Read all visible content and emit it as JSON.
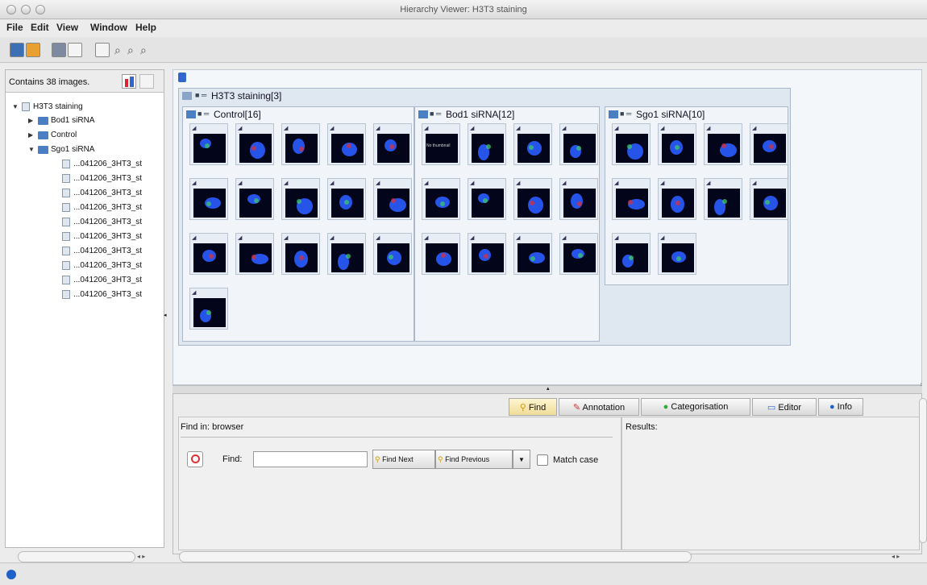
{
  "window": {
    "title": "Hierarchy Viewer: H3T3 staining"
  },
  "menubar": {
    "items": [
      "File",
      "Edit",
      "View",
      "Window",
      "Help"
    ]
  },
  "toolbar": {
    "icons": [
      "view-icon",
      "view-alt-icon",
      "grid-icon",
      "refresh-icon",
      "zoom-icon",
      "zoom-in-icon",
      "zoom-out-icon",
      "zoom-fit-icon"
    ]
  },
  "left_panel": {
    "header": "Contains 38 images.",
    "tree": {
      "root": "H3T3 staining",
      "groups": [
        "Bod1 siRNA",
        "Control",
        "Sgo1 siRNA"
      ],
      "files": [
        "...041206_3HT3_st",
        "...041206_3HT3_st",
        "...041206_3HT3_st",
        "...041206_3HT3_st",
        "...041206_3HT3_st",
        "...041206_3HT3_st",
        "...041206_3HT3_st",
        "...041206_3HT3_st",
        "...041206_3HT3_st",
        "...041206_3HT3_st"
      ]
    }
  },
  "browser": {
    "root_title": "H3T3 staining[3]",
    "groups": [
      {
        "title": "Control[16]",
        "count": 16
      },
      {
        "title": "Bod1 siRNA[12]",
        "count": 12
      },
      {
        "title": "Sgo1 siRNA[10]",
        "count": 10
      }
    ],
    "no_thumbnail_text": "No thumbnail"
  },
  "bottom": {
    "tabs": [
      "Find",
      "Annotation",
      "Categorisation",
      "Editor",
      "Info"
    ],
    "find_in_label": "Find in: browser",
    "find_label": "Find:",
    "find_value": "",
    "find_next_label": "Find Next",
    "find_previous_label": "Find Previous",
    "match_case_label": "Match case",
    "results_label": "Results:"
  },
  "colors": {
    "accent": "#4a7fc4",
    "thumbnail_bg": "#03051a",
    "cell_blue": "#2a5dff",
    "cell_green": "#3cc86e",
    "cell_red": "#d43040"
  }
}
